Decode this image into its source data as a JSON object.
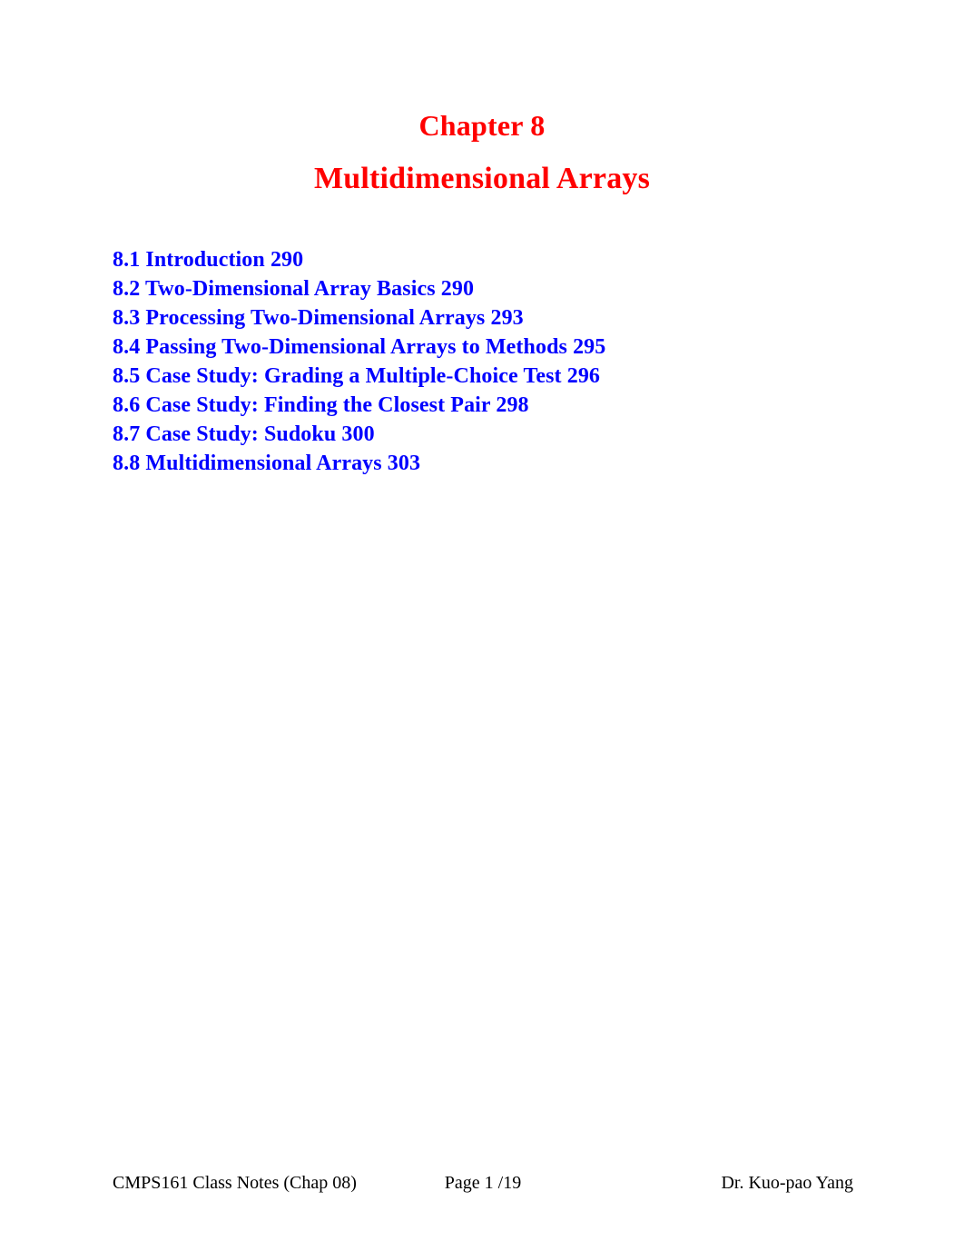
{
  "document": {
    "chapter_heading": "Chapter 8",
    "chapter_subheading": "Multidimensional Arrays",
    "heading_color": "#FF0000",
    "toc_color": "#0000FF",
    "body_color": "#000000",
    "page_background": "#FFFFFF"
  },
  "toc": {
    "entries": [
      {
        "text": "8.1 Introduction 290"
      },
      {
        "text": "8.2 Two-Dimensional Array Basics 290"
      },
      {
        "text": "8.3 Processing Two-Dimensional Arrays 293"
      },
      {
        "text": "8.4 Passing Two-Dimensional Arrays to Methods 295"
      },
      {
        "text": "8.5 Case Study: Grading a Multiple-Choice Test 296"
      },
      {
        "text": "8.6 Case Study: Finding the Closest Pair 298"
      },
      {
        "text": "8.7 Case Study: Sudoku 300"
      },
      {
        "text": "8.8 Multidimensional Arrays 303"
      }
    ]
  },
  "footer": {
    "left": "CMPS161 Class Notes (Chap 08)",
    "center": "Page 1 /19",
    "right": "Dr. Kuo-pao Yang"
  }
}
